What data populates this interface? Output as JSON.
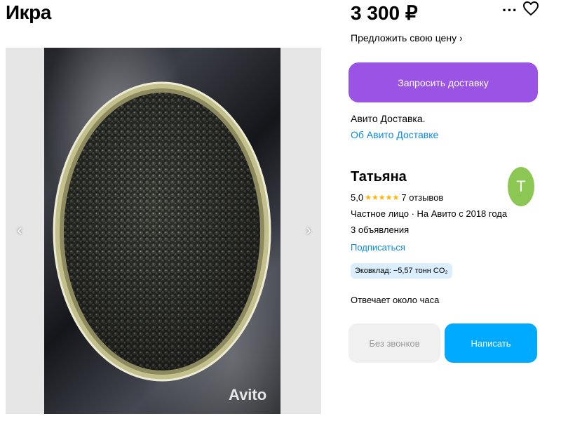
{
  "listing": {
    "title": "Икра",
    "price": "3 300 ₽",
    "offer_price_label": "Предложить свою цену ›",
    "watermark": "Avito"
  },
  "gallery": {
    "prev_icon": "‹",
    "next_icon": "›",
    "icon_names": [
      "chevron-left-icon",
      "chevron-right-icon"
    ]
  },
  "header_actions": {
    "more_icon": "···",
    "icon_names": [
      "more-icon",
      "heart-icon"
    ]
  },
  "delivery": {
    "request_button": "Запросить доставку",
    "text": "Авито Доставка.",
    "link": "Об Авито Доставке"
  },
  "seller": {
    "name": "Татьяна",
    "avatar_letter": "Т",
    "rating": "5,0",
    "stars": "★★★★★",
    "rating_value": 5,
    "reviews": "7 отзывов",
    "info": "Частное лицо · На Авито с 2018 года",
    "listings": "3 объявления",
    "subscribe": "Подписаться",
    "eco_badge": "Эковклад: −5,57 тонн CO₂",
    "response_time": "Отвечает около часа"
  },
  "contact": {
    "no_calls_button": "Без звонков",
    "write_button": "Написать"
  },
  "colors": {
    "accent_purple": "#9b53e6",
    "link_blue": "#0a8ae0",
    "write_button": "#00aaff",
    "avatar_green": "#8cc653",
    "star_yellow": "#ffb400",
    "eco_badge_bg": "#daeefe"
  }
}
